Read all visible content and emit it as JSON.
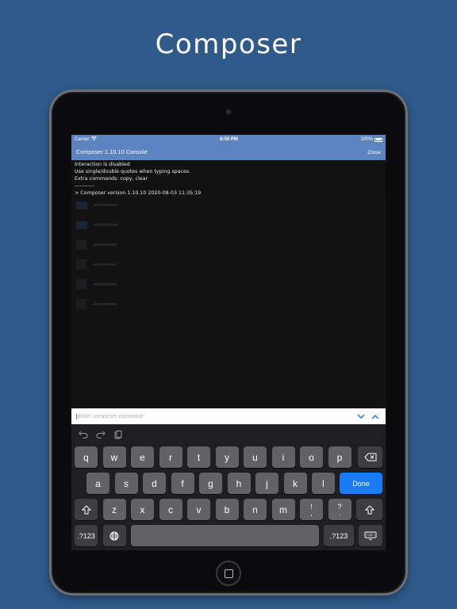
{
  "headline": "Composer",
  "status": {
    "carrier": "Carrier",
    "time": "8:50 PM",
    "battery": "100%"
  },
  "nav": {
    "title": "Composer 1.10.10 Console",
    "close": "Close"
  },
  "console_lines": [
    "Interaction is disabled",
    "Use single/double quotes when typing spaces.",
    "Extra commands: copy, clear",
    "-----------",
    "> Composer version 1.10.10 2020-08-03 11:35:19"
  ],
  "command_input": {
    "placeholder": "Enter composer command",
    "value": ""
  },
  "keyboard": {
    "row1": [
      "q",
      "w",
      "e",
      "r",
      "t",
      "y",
      "u",
      "i",
      "o",
      "p"
    ],
    "row2": [
      "a",
      "s",
      "d",
      "f",
      "g",
      "h",
      "j",
      "k",
      "l"
    ],
    "done": "Done",
    "row3": [
      "z",
      "x",
      "c",
      "v",
      "b",
      "n",
      "m"
    ],
    "punct1": {
      "top": "!",
      "bottom": ","
    },
    "punct2": {
      "top": "?",
      "bottom": "."
    },
    "numbers_left": ".?123",
    "numbers_right": ".?123"
  },
  "icons": {
    "wifi": "wifi-icon",
    "battery": "battery-icon",
    "history_down": "chevron-down-icon",
    "history_up": "chevron-up-icon",
    "undo": "undo-icon",
    "redo": "redo-icon",
    "paste": "paste-icon",
    "backspace": "backspace-icon",
    "shift": "shift-icon",
    "globe": "globe-icon",
    "hide_keyboard": "keyboard-hide-icon"
  },
  "colors": {
    "background": "#2f5a8a",
    "navbar": "#5d84c0",
    "done_key": "#1a7cf5",
    "key": "#626266",
    "key_dark": "#3e3e42"
  }
}
